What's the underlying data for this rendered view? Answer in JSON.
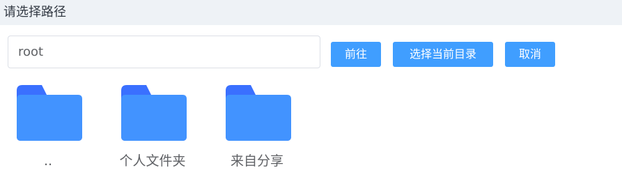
{
  "header": {
    "title": "请选择路径"
  },
  "path_input": {
    "value": "root"
  },
  "buttons": {
    "go_label": "前往",
    "select_current_label": "选择当前目录",
    "cancel_label": "取消"
  },
  "folders": [
    {
      "name": "..",
      "icon": "folder-icon"
    },
    {
      "name": "个人文件夹",
      "icon": "folder-icon"
    },
    {
      "name": "来自分享",
      "icon": "folder-icon"
    }
  ],
  "colors": {
    "accent": "#409eff",
    "folder_back": "#3a70ff",
    "folder_front": "#4293ff",
    "header_bg": "#eef2f6"
  }
}
